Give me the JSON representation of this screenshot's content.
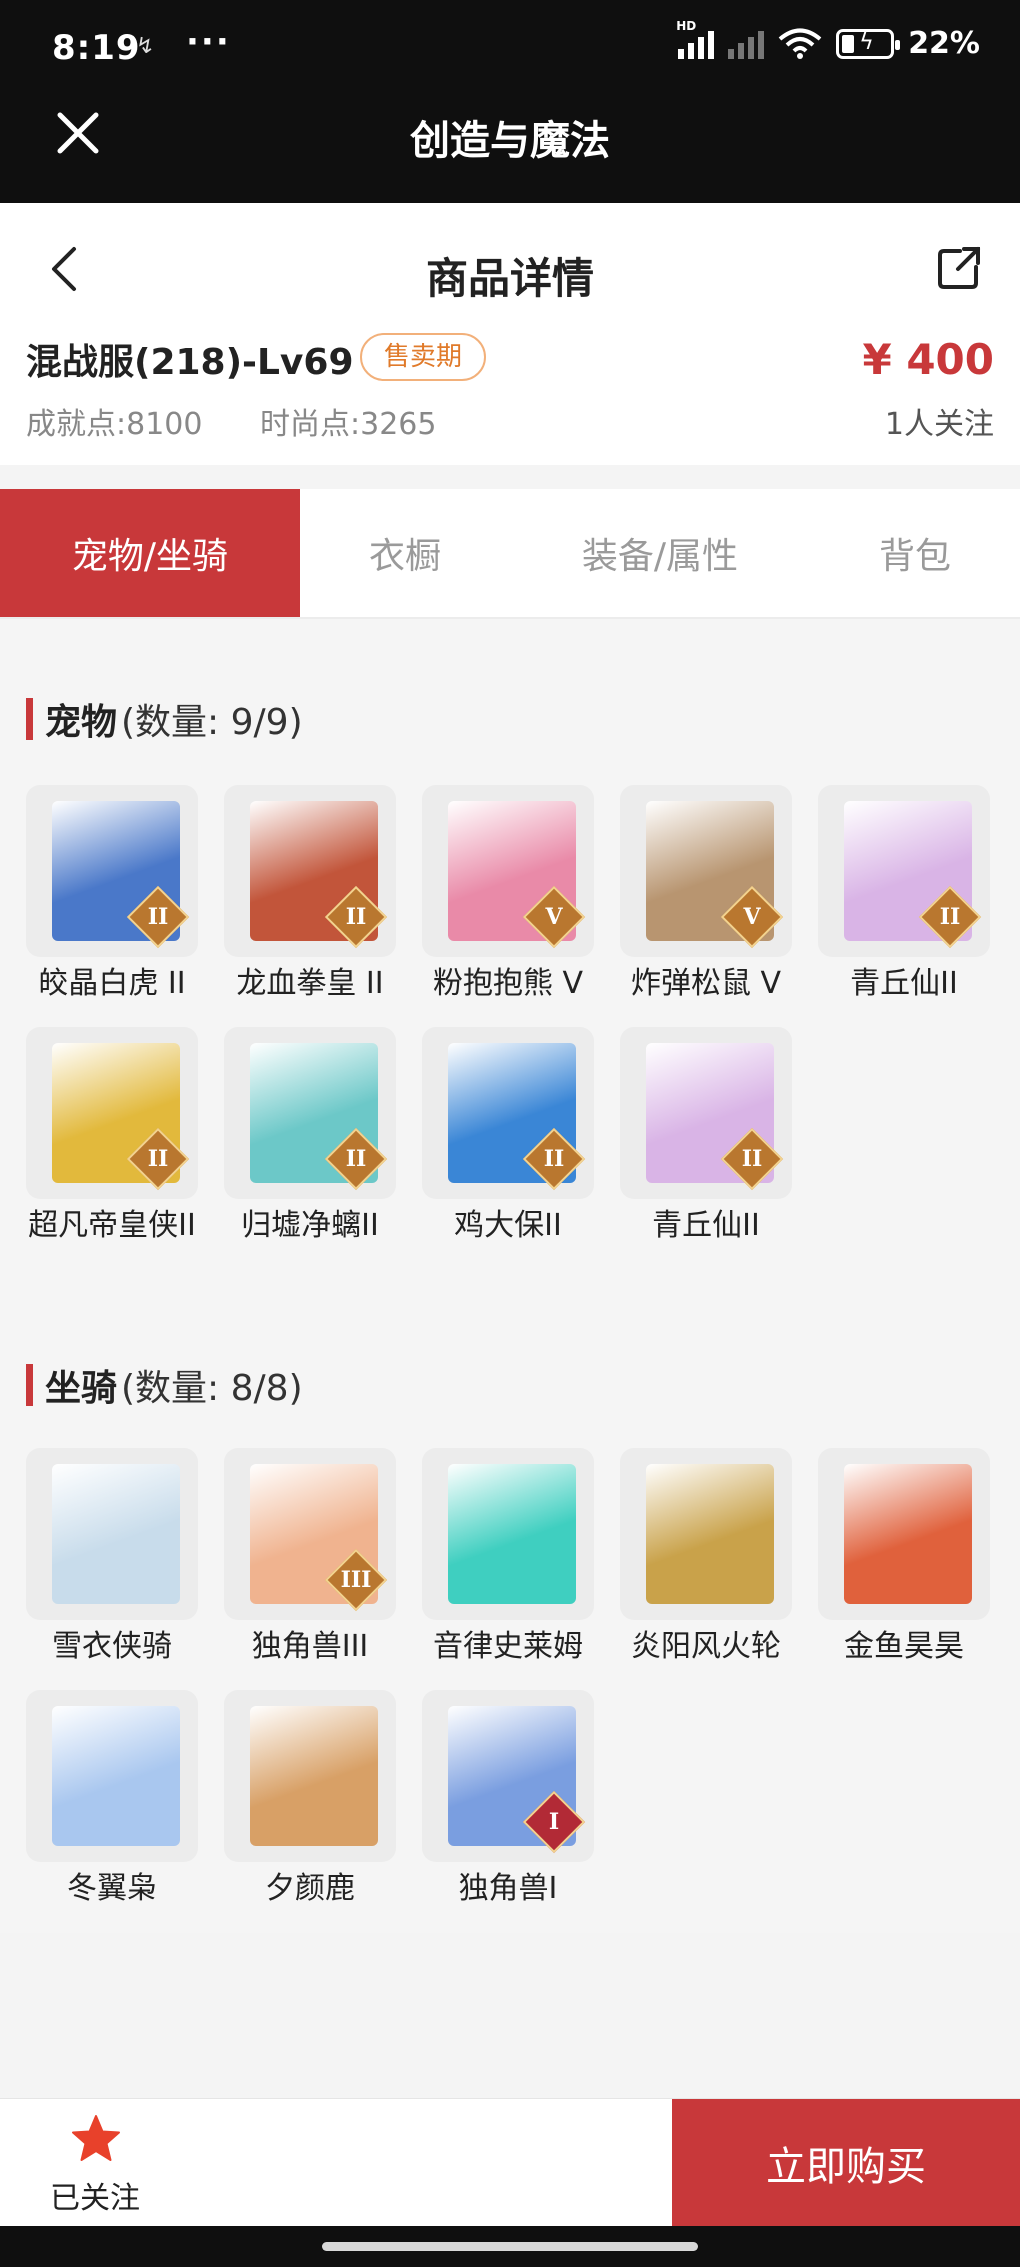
{
  "status_bar": {
    "time": "8:19",
    "mini_icon": "↯",
    "dots": "···",
    "network_label": "HD",
    "battery_percent": "22%"
  },
  "app_bar": {
    "title": "创造与魔法"
  },
  "header": {
    "page_title": "商品详情",
    "item_name": "混战服(218)-Lv69",
    "status_badge": "售卖期",
    "price": "¥ 400",
    "achievement_label": "成就点:8100",
    "fashion_label": "时尚点:3265",
    "followers": "1人关注"
  },
  "tabs": [
    {
      "label": "宠物/坐骑",
      "active": true
    },
    {
      "label": "衣橱",
      "active": false
    },
    {
      "label": "装备/属性",
      "active": false
    },
    {
      "label": "背包",
      "active": false
    }
  ],
  "pets": {
    "title": "宠物",
    "count": "(数量: 9/9)",
    "items": [
      {
        "name": "皎晶白虎 II",
        "rank": "II",
        "color": "#4a78c9"
      },
      {
        "name": "龙血拳皇 II",
        "rank": "II",
        "color": "#c2553a"
      },
      {
        "name": "粉抱抱熊 V",
        "rank": "V",
        "color": "#e98aa8"
      },
      {
        "name": "炸弹松鼠 V",
        "rank": "V",
        "color": "#b89570"
      },
      {
        "name": "青丘仙II",
        "rank": "II",
        "color": "#d9b4e6"
      },
      {
        "name": "超凡帝皇侠II",
        "rank": "II",
        "color": "#e2b93c"
      },
      {
        "name": "归墟净螭II",
        "rank": "II",
        "color": "#6cc8c8"
      },
      {
        "name": "鸡大保II",
        "rank": "II",
        "color": "#3a86d6"
      },
      {
        "name": "青丘仙II",
        "rank": "II",
        "color": "#d9b4e6"
      }
    ]
  },
  "mounts": {
    "title": "坐骑",
    "count": "(数量: 8/8)",
    "items": [
      {
        "name": "雪衣侠骑",
        "rank": "",
        "color": "#c8dceb"
      },
      {
        "name": "独角兽III",
        "rank": "III",
        "color": "#f0b38f"
      },
      {
        "name": "音律史莱姆",
        "rank": "",
        "color": "#3fcfc0"
      },
      {
        "name": "炎阳风火轮",
        "rank": "",
        "color": "#c9a24a"
      },
      {
        "name": "金鱼昊昊",
        "rank": "",
        "color": "#e0613c"
      },
      {
        "name": "冬翼枭",
        "rank": "",
        "color": "#a9c7ef"
      },
      {
        "name": "夕颜鹿",
        "rank": "",
        "color": "#d8a066"
      },
      {
        "name": "独角兽I",
        "rank": "I",
        "color": "#7a9ee0"
      }
    ]
  },
  "bottom_bar": {
    "follow_label": "已关注",
    "buy_label": "立即购买"
  },
  "colors": {
    "accent": "#c8383a",
    "badge": "#e07a2a"
  }
}
